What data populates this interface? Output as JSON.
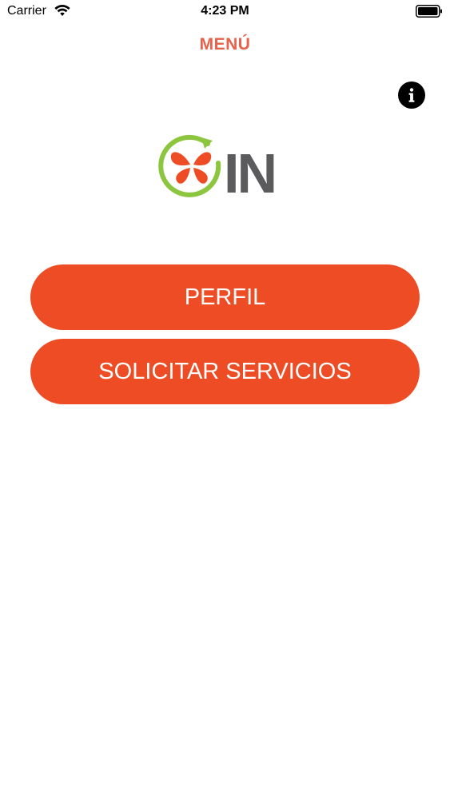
{
  "status_bar": {
    "carrier": "Carrier",
    "time": "4:23 PM",
    "wifi_icon": "wifi-icon",
    "battery_icon": "battery-icon"
  },
  "header": {
    "title": "MENÚ"
  },
  "info_button": {
    "icon": "info-icon"
  },
  "logo": {
    "text": "IN",
    "icon": "butterfly-refresh-icon"
  },
  "menu": {
    "perfil_label": "PERFIL",
    "servicios_label": "SOLICITAR SERVICIOS"
  },
  "colors": {
    "accent": "#EE4C25",
    "title": "#E8614A",
    "logo_green": "#8CC63F",
    "logo_gray": "#5B5B5D"
  }
}
